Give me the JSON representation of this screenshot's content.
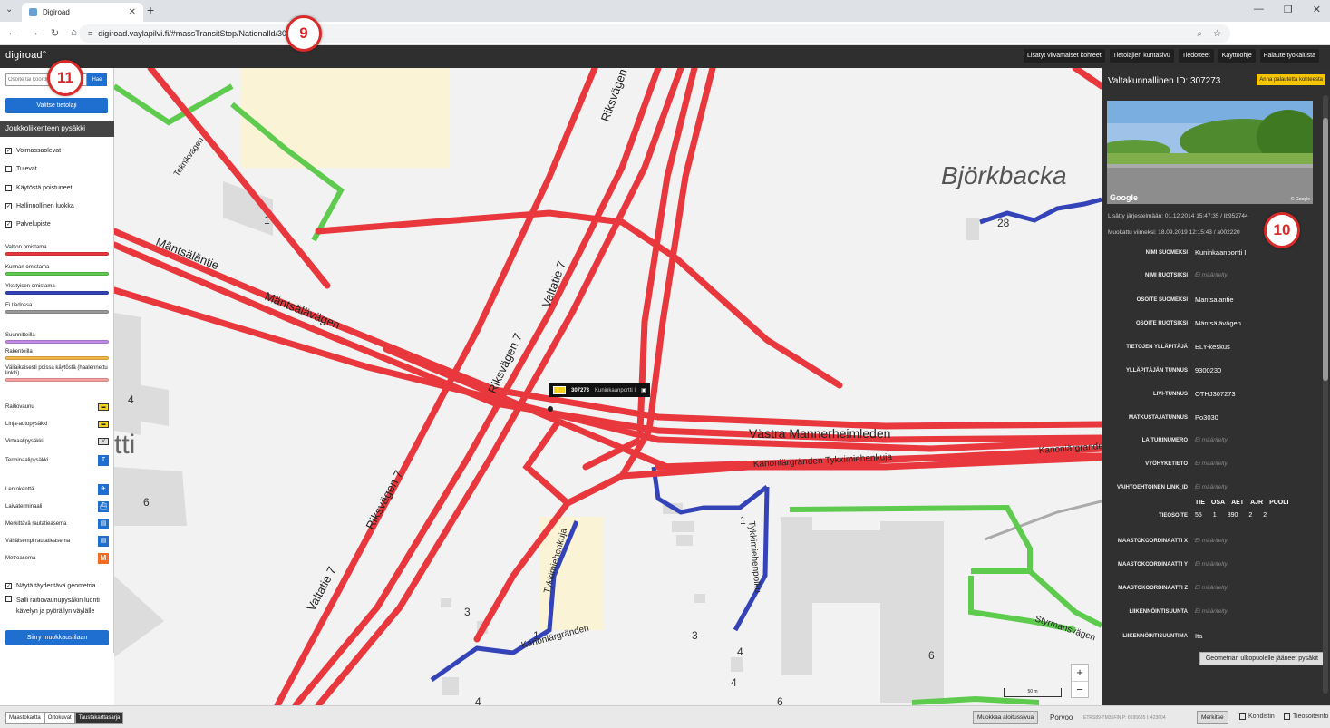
{
  "browser": {
    "tab_title": "Digiroad",
    "url_site": "≡",
    "url": "digiroad.vaylapilvi.fi/#massTransitStop/Nationalld/307273"
  },
  "badges": {
    "url_badge": "9",
    "search_badge": "11",
    "panel_badge": "10"
  },
  "header": {
    "logo": "digiroad°",
    "nav": [
      "Lisätyt viivamaiset kohteet",
      "Tietolajien kuntasivu",
      "Tiedotteet",
      "Käyttöohje",
      "Palaute työkalusta"
    ]
  },
  "sidebar": {
    "search_placeholder": "Osoite tai koordinaatit",
    "search_button": "Hae",
    "layer_button": "Valitse tietolaji",
    "section_title": "Joukkoliikenteen pysäkki",
    "checkboxes": [
      {
        "label": "Voimassaolevat",
        "checked": "✓"
      },
      {
        "label": "Tulevat",
        "checked": ""
      },
      {
        "label": "Käytöstä poistuneet",
        "checked": ""
      },
      {
        "label": "Hallinnollinen luokka",
        "checked": "✓"
      },
      {
        "label": "Palvelupiste",
        "checked": "✓"
      }
    ],
    "ownership": [
      {
        "label": "Valtion omistama",
        "color": "#e8383d"
      },
      {
        "label": "Kunnan omistama",
        "color": "#5ecb4f"
      },
      {
        "label": "Yksityisen omistama",
        "color": "#3444b8"
      },
      {
        "label": "Ei tiedossa",
        "color": "#999999"
      }
    ],
    "status": [
      {
        "label": "Suunnitteilla",
        "color": "#c08ae8"
      },
      {
        "label": "Rakenteilla",
        "color": "#f3b64a"
      },
      {
        "label": "Väliaikaisesti poissa käytöstä (haalennettu linkki)",
        "color": "#f7a0a0"
      }
    ],
    "stop_types": [
      {
        "label": "Raitiovaunu",
        "icon": "tram-stop-icon"
      },
      {
        "label": "Linja-autopysäkki",
        "icon": "bus-stop-icon"
      },
      {
        "label": "Virtuaalipysäkki",
        "icon": "virtual-stop-icon"
      },
      {
        "label": "Terminaalipysäkki",
        "icon": "terminal-stop-icon"
      }
    ],
    "service_types": [
      {
        "label": "Lentokenttä",
        "icon": "airport-icon"
      },
      {
        "label": "Laivaterminaali",
        "icon": "ferry-icon"
      },
      {
        "label": "Merkittävä rautatieasema",
        "icon": "train-major-icon"
      },
      {
        "label": "Vähäisempi rautatieasema",
        "icon": "train-minor-icon"
      },
      {
        "label": "Metroasema",
        "icon": "metro-icon"
      }
    ],
    "options": [
      {
        "label": "Näytä täydentävä geometria",
        "checked": "✓"
      },
      {
        "label": "Salli raitiovaunupysäkin luonti kävelyn ja pyöräilyn väylälle",
        "checked": ""
      }
    ],
    "edit_button": "Siirry muokkaustilaan"
  },
  "map": {
    "labels": {
      "bjorkbacka": "Björkbacka",
      "mantsalantie": "Mäntsäläntie",
      "mantsalavagen": "Mäntsälävägen",
      "riksvagen7a": "Riksvägen 7",
      "valtatie7a": "Valtatie 7",
      "riksvagen7b": "Riksvägen 7",
      "valtatie7b": "Valtatie 7",
      "riksvagen7c": "Riksvägen 7",
      "vastra": "Västra Mannerheimleden",
      "kanoniargranden": "Kanoniärgranden",
      "kanoniargranden_tyk": "Kanoniärgränden Tykkimiehenkuja",
      "tykkimiehenpolku": "Tykkimiehenpolku",
      "tykkimiehenkuja": "Tykkimiehenkuja",
      "kanoniargranden2": "Kanoniärgränden",
      "teknikvagen": "Teknikvägen",
      "styrmansvagen": "Styrmansvägen",
      "tti": "tti",
      "num_1a": "1",
      "num_28": "28",
      "num_4a": "4",
      "num_6a": "6",
      "num_1b": "1",
      "num_3a": "3",
      "num_1c": "1",
      "num_3b": "3",
      "num_4b": "4",
      "num_4c": "4",
      "num_4d": "4",
      "num_6b": "6",
      "num_6c": "6"
    },
    "popup": {
      "id": "307273",
      "name": "Kuninkaanportti I"
    },
    "zoom_in": "+",
    "zoom_out": "−",
    "scale": "50 m"
  },
  "panel": {
    "title": "Valtakunnallinen ID: 307273",
    "report_button": "Anna palautetta kohteesta",
    "google": "Google",
    "google_copy": "© Google",
    "added": "Lisätty järjestelmään: 01.12.2014 15:47:35 / lb952744",
    "modified": "Muokattu viimeksi: 18.09.2019 12:15:43 / a002220",
    "fields": [
      {
        "label": "NIMI SUOMEKSI",
        "value": "Kuninkaanportti I",
        "empty": false
      },
      {
        "label": "NIMI RUOTSIKSI",
        "value": "Ei määritelty",
        "empty": true
      },
      {
        "label": "OSOITE SUOMEKSI",
        "value": "Mantsalantie",
        "empty": false
      },
      {
        "label": "OSOITE RUOTSIKSI",
        "value": "Mäntsälävägen",
        "empty": false
      },
      {
        "label": "TIETOJEN YLLÄPITÄJÄ",
        "value": "ELY-keskus",
        "empty": false
      },
      {
        "label": "YLLÄPITÄJÄN TUNNUS",
        "value": "9300230",
        "empty": false
      },
      {
        "label": "LIVI-TUNNUS",
        "value": "OTHJ307273",
        "empty": false
      },
      {
        "label": "MATKUSTAJATUNNUS",
        "value": "Po3030",
        "empty": false
      },
      {
        "label": "LAITURINUMERO",
        "value": "Ei määritelty",
        "empty": true
      },
      {
        "label": "VYÖHYKETIETO",
        "value": "Ei määritelty",
        "empty": true
      },
      {
        "label": "VAIHTOEHTOINEN LINK_ID",
        "value": "Ei määritelty",
        "empty": true
      }
    ],
    "tieosoite": {
      "label": "TIEOSOITE",
      "headers": [
        "TIE",
        "OSA",
        "AET",
        "AJR",
        "PUOLI"
      ],
      "values": [
        "55",
        "1",
        "890",
        "2",
        "2"
      ]
    },
    "fields2": [
      {
        "label": "MAASTOKOORDINAATTI X",
        "value": "Ei määritelty",
        "empty": true
      },
      {
        "label": "MAASTOKOORDINAATTI Y",
        "value": "Ei määritelty",
        "empty": true
      },
      {
        "label": "MAASTOKOORDINAATTI Z",
        "value": "Ei määritelty",
        "empty": true
      },
      {
        "label": "LIIKENNÖINTISUUNTA",
        "value": "Ei määritelty",
        "empty": true
      },
      {
        "label": "LIIKENNÖINTISUUNTIMA",
        "value": "Ita",
        "empty": false
      }
    ],
    "geom_button": "Geometrian ulkopuolelle jääneet pysäkit"
  },
  "bottom": {
    "bg_options": [
      "Maastokartta",
      "Ortokuvat",
      "Taustakarttasarja"
    ],
    "start_button": "Muokkaa aloitussivua",
    "municipality": "Porvoo",
    "coords": "ETRS89-TM35FIN  P: 6695685  I: 423604",
    "mark_button": "Merkitse",
    "target_label": "Kohdistin",
    "roadinfo_label": "Tieosoiteinfo"
  },
  "colors": {
    "state": "#e8383d",
    "municipal": "#5ecb4f",
    "private": "#3444b8"
  }
}
